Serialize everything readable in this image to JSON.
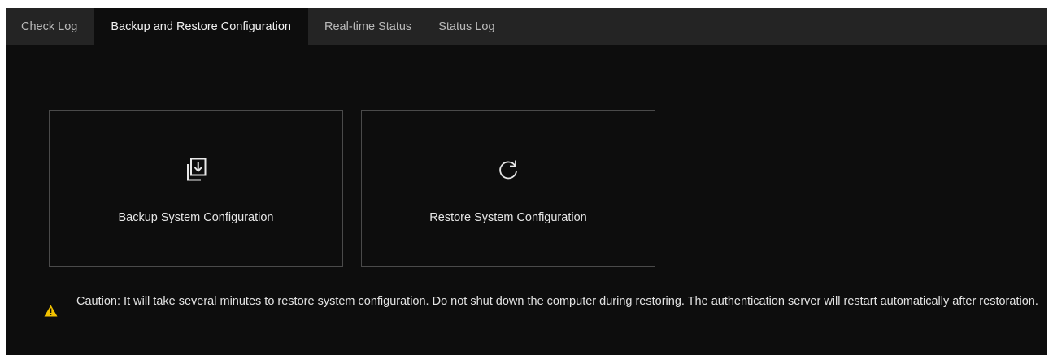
{
  "tabs": [
    {
      "label": "Check Log",
      "active": false
    },
    {
      "label": "Backup and Restore Configuration",
      "active": true
    },
    {
      "label": "Real-time Status",
      "active": false
    },
    {
      "label": "Status Log",
      "active": false
    }
  ],
  "cards": {
    "backup": {
      "label": "Backup System Configuration",
      "icon": "backup-download-icon"
    },
    "restore": {
      "label": "Restore System Configuration",
      "icon": "restore-refresh-icon"
    }
  },
  "caution": {
    "icon": "warning-icon",
    "text": "Caution: It will take several minutes to restore system configuration. Do not shut down the computer during restoring. The authentication server will restart automatically after restoration."
  },
  "colors": {
    "panel_background": "#0d0d0d",
    "tabbar_background": "#242424",
    "card_border": "#4a4a4a",
    "warning_yellow": "#f2c200"
  }
}
